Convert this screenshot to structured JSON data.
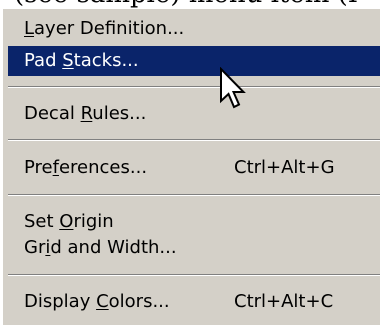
{
  "caption": {
    "text": "(see sample) menu item (I"
  },
  "menu": {
    "items": [
      {
        "pre": "",
        "mnemonic": "L",
        "post": "ayer Definition...",
        "shortcut": ""
      },
      {
        "pre": "Pad ",
        "mnemonic": "S",
        "post": "tacks...",
        "shortcut": ""
      },
      {
        "pre": "Decal ",
        "mnemonic": "R",
        "post": "ules...",
        "shortcut": ""
      },
      {
        "pre": "Pre",
        "mnemonic": "f",
        "post": "erences...",
        "shortcut": "Ctrl+Alt+G"
      },
      {
        "pre": "Set ",
        "mnemonic": "O",
        "post": "rigin",
        "shortcut": ""
      },
      {
        "pre": "Gr",
        "mnemonic": "i",
        "post": "d and Width...",
        "shortcut": ""
      },
      {
        "pre": "Display ",
        "mnemonic": "C",
        "post": "olors...",
        "shortcut": "Ctrl+Alt+C"
      }
    ],
    "highlighted_index": 1,
    "colors": {
      "menu_background": "#d4d0c8",
      "highlight": "#0a246a",
      "highlight_text": "#ffffff"
    }
  },
  "cursor": {
    "icon": "arrow-pointer-icon"
  }
}
